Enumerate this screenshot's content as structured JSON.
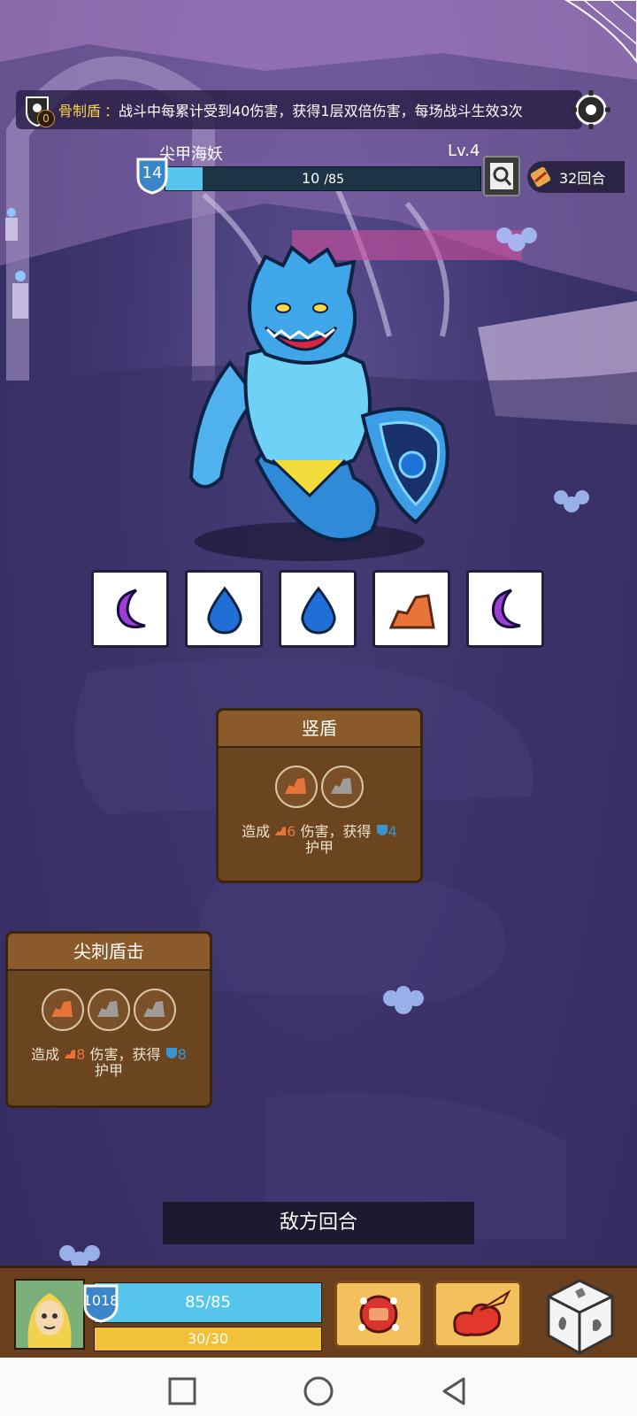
{
  "relic": {
    "name": "骨制盾",
    "colon": "：",
    "description": "战斗中每累计受到40伤害，获得1层双倍伤害，每场战斗生效3次",
    "count": "0"
  },
  "enemy": {
    "name": "尖甲海妖",
    "level": "Lv.4",
    "armor": "14",
    "hp_current": "10",
    "hp_max": "/85",
    "hp_fraction": 0.118
  },
  "rounds": "32回合",
  "intents": [
    "moon-icon",
    "water-drop-icon",
    "water-drop-icon",
    "rock-icon",
    "moon-icon"
  ],
  "cards": [
    {
      "title": "竖盾",
      "slots": [
        "rock-orange",
        "rock-gray"
      ],
      "desc_prefix": "造成",
      "damage": "6",
      "desc_mid": "伤害，获得",
      "armor": "4",
      "desc_suffix": "护甲"
    },
    {
      "title": "尖刺盾击",
      "slots": [
        "rock-orange",
        "rock-gray",
        "rock-gray"
      ],
      "desc_prefix": "造成",
      "damage": "8",
      "desc_mid": "伤害，获得",
      "armor": "8",
      "desc_suffix": "护甲"
    }
  ],
  "turn_label": "敌方回合",
  "player": {
    "armor": "1018",
    "hp": "85/85",
    "energy": "30/30"
  },
  "colors": {
    "hp_blue": "#57c6ef",
    "energy_yellow": "#f1c13a",
    "rock_orange": "#e8743a",
    "moon_purple": "#9b3fd6",
    "water_blue": "#1f6fd6"
  }
}
